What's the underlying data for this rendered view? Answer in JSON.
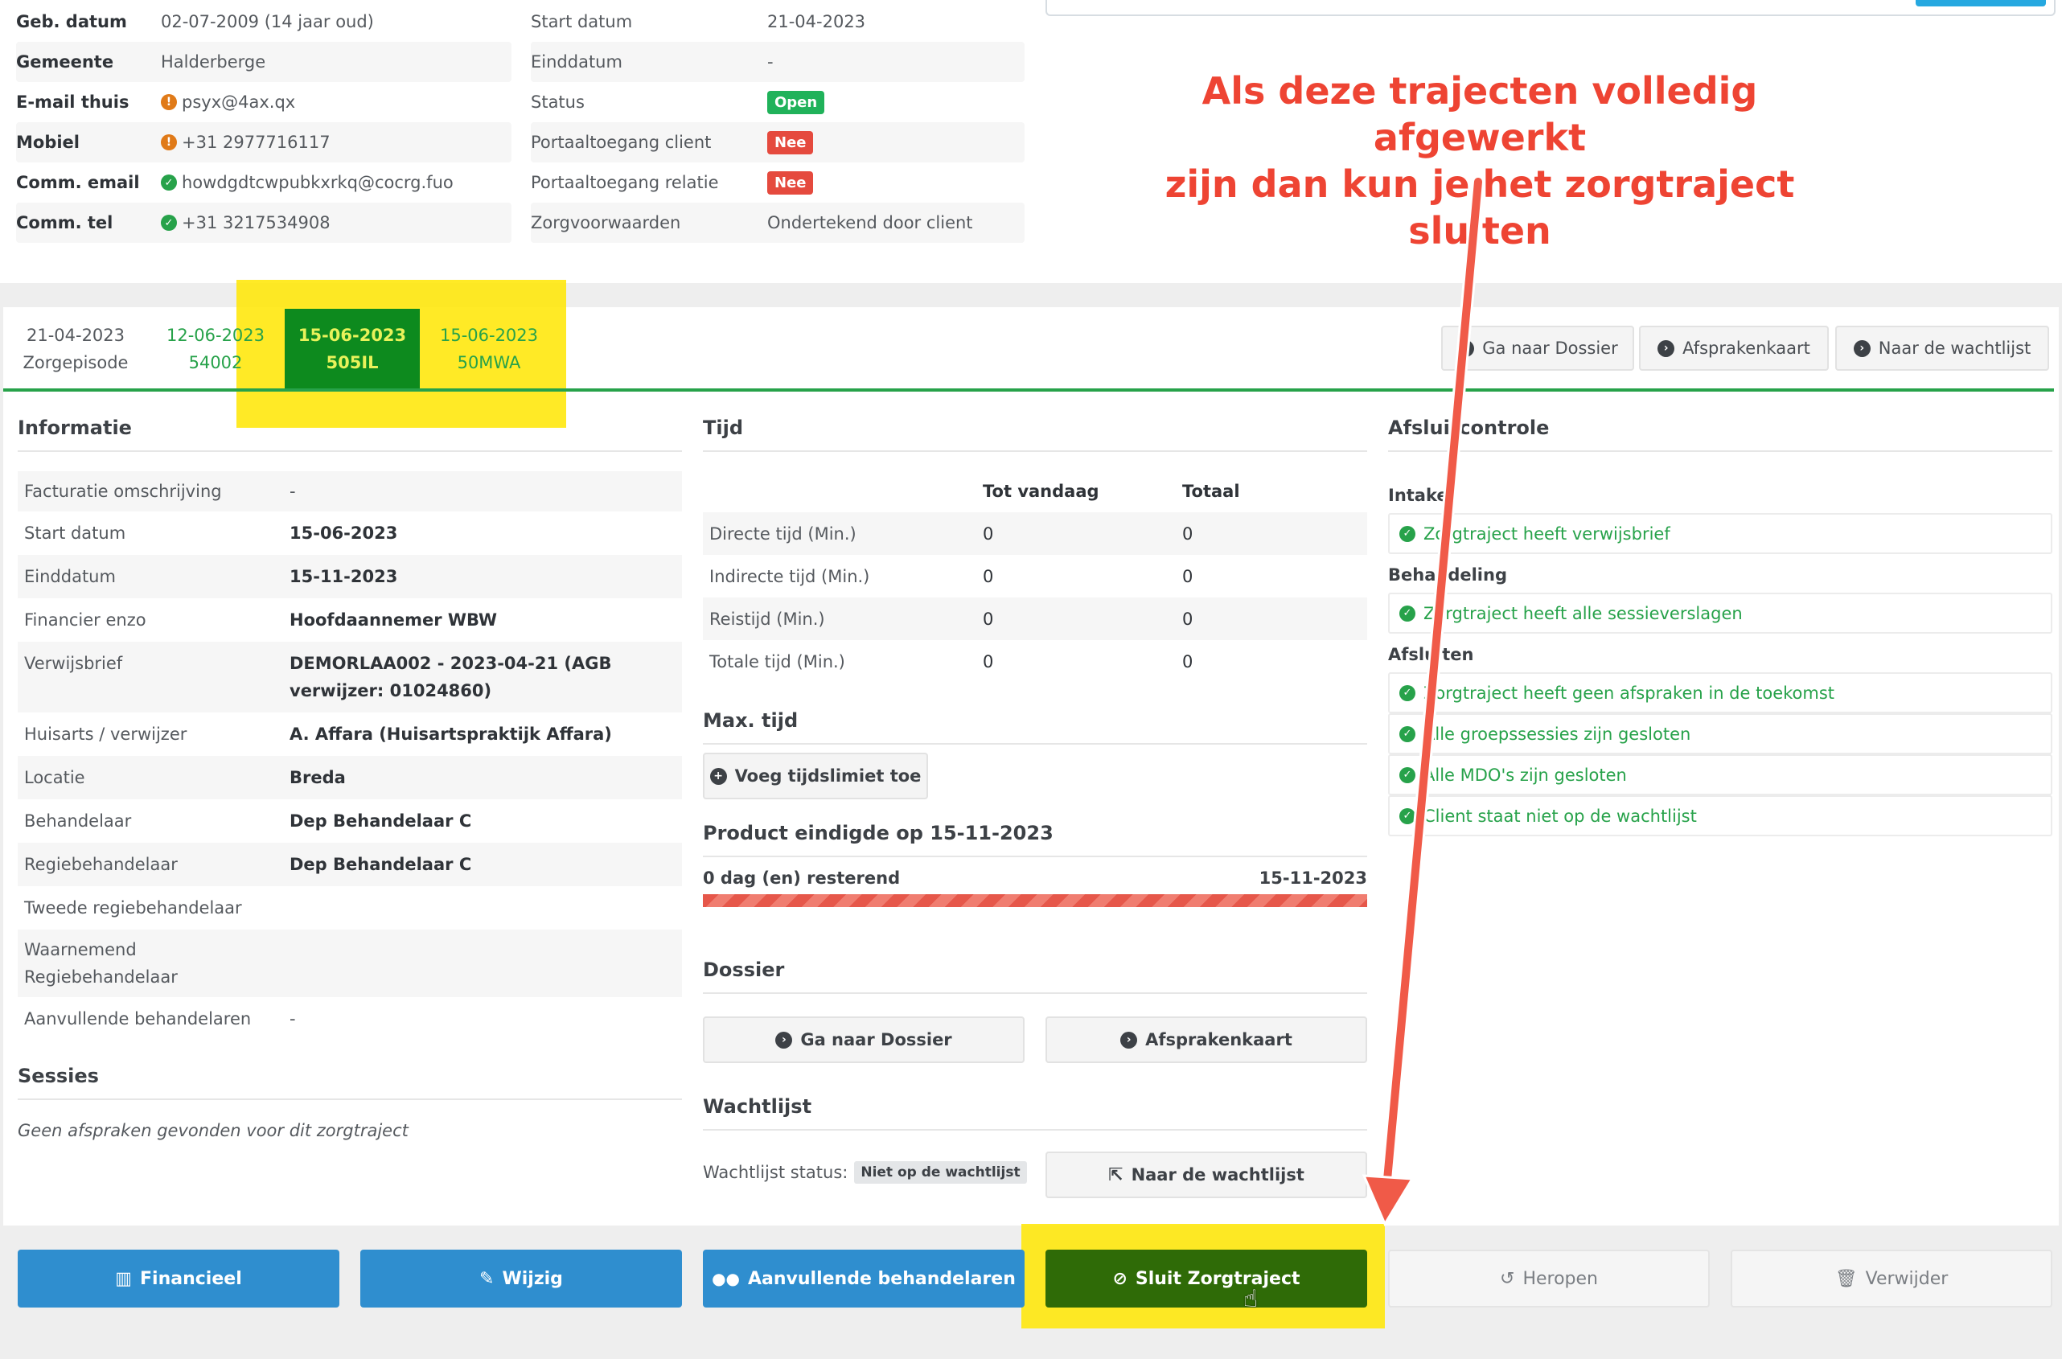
{
  "client": {
    "left": [
      {
        "label": "Geb. datum",
        "value": "02-07-2009 (14 jaar oud)",
        "icon": ""
      },
      {
        "label": "Gemeente",
        "value": "Halderberge",
        "icon": ""
      },
      {
        "label": "E-mail thuis",
        "value": "psyx@4ax.qx",
        "icon": "warning-icon"
      },
      {
        "label": "Mobiel",
        "value": "+31 2977716117",
        "icon": "warning-icon"
      },
      {
        "label": "Comm. email",
        "value": "howdgdtcwpubkxrkq@cocrg.fuo",
        "icon": "check-icon"
      },
      {
        "label": "Comm. tel",
        "value": "+31 3217534908",
        "icon": "check-icon"
      }
    ],
    "right": [
      {
        "label": "Start datum",
        "value": "21-04-2023"
      },
      {
        "label": "Einddatum",
        "value": "-"
      },
      {
        "label": "Status",
        "badge": "Open",
        "badge_color": "#20b25a"
      },
      {
        "label": "Portaaltoegang client",
        "badge": "Nee",
        "badge_color": "#e54a3e"
      },
      {
        "label": "Portaaltoegang relatie",
        "badge": "Nee",
        "badge_color": "#e54a3e"
      },
      {
        "label": "Zorgvoorwaarden",
        "value": "Ondertekend door client"
      }
    ]
  },
  "tabs": [
    {
      "line1": "21-04-2023",
      "line2": "Zorgepisode",
      "state": "plain"
    },
    {
      "line1": "12-06-2023",
      "line2": "54002",
      "state": "link"
    },
    {
      "line1": "15-06-2023",
      "line2": "505IL",
      "state": "active"
    },
    {
      "line1": "15-06-2023",
      "line2": "50MWA",
      "state": "link"
    }
  ],
  "top_buttons": {
    "dossier": "Ga naar Dossier",
    "afsprakenkaart": "Afsprakenkaart",
    "wachtlijst": "Naar de wachtlijst"
  },
  "informatie": {
    "title": "Informatie",
    "rows": [
      {
        "label": "Facturatie omschrijving",
        "value": "-"
      },
      {
        "label": "Start datum",
        "value": "15-06-2023"
      },
      {
        "label": "Einddatum",
        "value": "15-11-2023"
      },
      {
        "label": "Financier enzo",
        "value": "Hoofdaannemer WBW"
      },
      {
        "label": "Verwijsbrief",
        "value": "DEMORLAA002 - 2023-04-21 (AGB verwijzer: 01024860)"
      },
      {
        "label": "Huisarts / verwijzer",
        "value": "A. Affara (Huisartspraktijk Affara)"
      },
      {
        "label": "Locatie",
        "value": "Breda"
      },
      {
        "label": "Behandelaar",
        "value": "Dep Behandelaar C"
      },
      {
        "label": "Regiebehandelaar",
        "value": "Dep Behandelaar C"
      },
      {
        "label": "Tweede regiebehandelaar",
        "value": ""
      },
      {
        "label": "Waarnemend Regiebehandelaar",
        "value": ""
      },
      {
        "label": "Aanvullende behandelaren",
        "value": "-"
      }
    ]
  },
  "sessies": {
    "title": "Sessies",
    "empty": "Geen afspraken gevonden voor dit zorgtraject"
  },
  "tijd": {
    "title": "Tijd",
    "col1": "Tot vandaag",
    "col2": "Totaal",
    "rows": [
      {
        "label": "Directe tijd (Min.)",
        "tot": "0",
        "totaal": "0"
      },
      {
        "label": "Indirecte tijd (Min.)",
        "tot": "0",
        "totaal": "0"
      },
      {
        "label": "Reistijd (Min.)",
        "tot": "0",
        "totaal": "0"
      },
      {
        "label": "Totale tijd (Min.)",
        "tot": "0",
        "totaal": "0"
      }
    ],
    "max_title": "Max. tijd",
    "max_button": "Voeg tijdslimiet toe",
    "product_title": "Product eindigde op 15-11-2023",
    "remaining": "0 dag (en) resterend",
    "end_date": "15-11-2023",
    "progress": 1.0
  },
  "dossier": {
    "title": "Dossier",
    "btn_dossier": "Ga naar Dossier",
    "btn_afspraken": "Afsprakenkaart"
  },
  "wachtlijst": {
    "title": "Wachtlijst",
    "status_label": "Wachtlijst status:",
    "status_badge": "Niet op de wachtlijst",
    "button": "Naar de wachtlijst"
  },
  "afsluitcontrole": {
    "title": "Afsluitcontrole",
    "groups": [
      {
        "name": "Intake",
        "items": [
          "Zorgtraject heeft verwijsbrief"
        ]
      },
      {
        "name": "Behandeling",
        "items": [
          "Zorgtraject heeft alle sessieverslagen"
        ]
      },
      {
        "name": "Afsluiten",
        "items": [
          "Zorgtraject heeft geen afspraken in de toekomst",
          "Alle groepssessies zijn gesloten",
          "Alle MDO's zijn gesloten",
          "Client staat niet op de wachtlijst"
        ]
      }
    ]
  },
  "bottom_buttons": {
    "financieel": "Financieel",
    "wijzig": "Wijzig",
    "aanvullende": "Aanvullende behandelaren",
    "sluit": "Sluit Zorgtraject",
    "heropen": "Heropen",
    "verwijder": "Verwijder"
  },
  "annotation": {
    "line1": "Als deze trajecten volledig afgewerkt",
    "line2": "zijn dan kun je het zorgtraject sluiten",
    "color": "#ee4433"
  },
  "colors": {
    "accent_green": "#27a24a",
    "active_tab": "#0d8a1e",
    "highlight": "#ffe600",
    "primary_blue": "#2f8ecf",
    "close_green": "#2f6b07"
  }
}
